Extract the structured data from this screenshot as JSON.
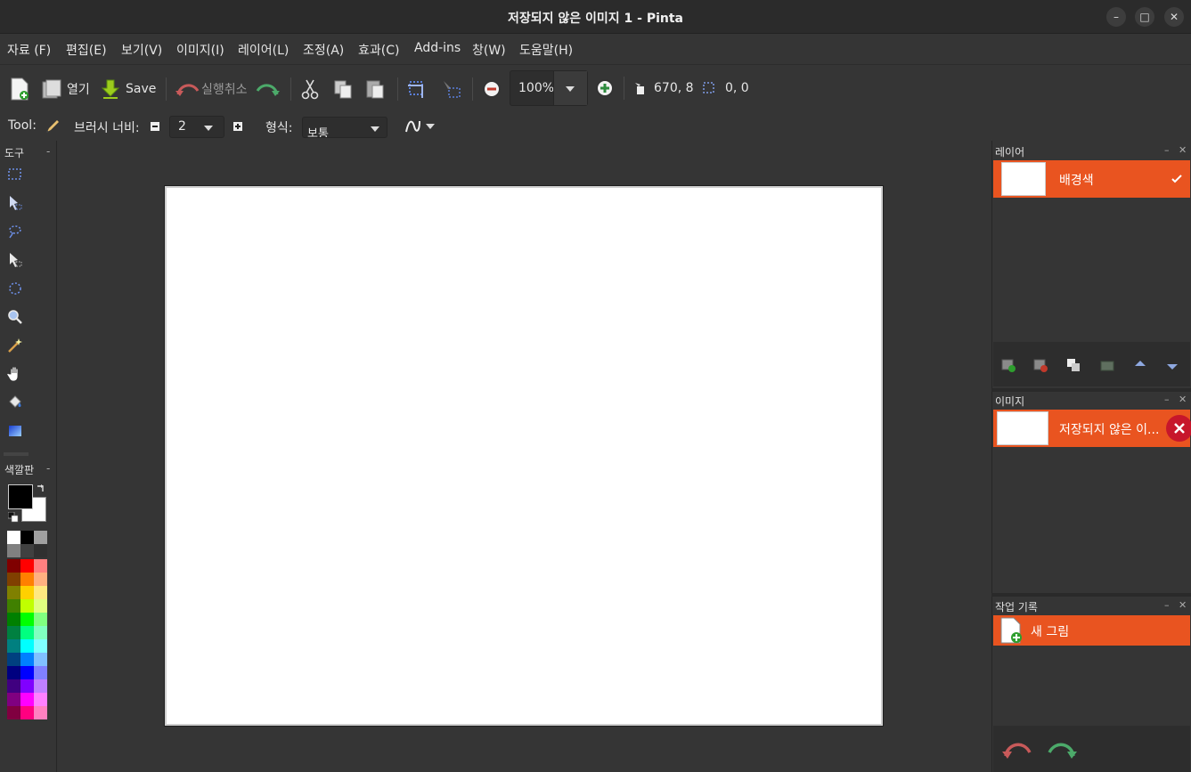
{
  "window": {
    "title": "저장되지 않은 이미지 1 - Pinta",
    "minimize": "–",
    "maximize": "□",
    "close": "✕"
  },
  "menu": {
    "items": [
      "자료 (F)",
      "편집(E)",
      "보기(V)",
      "이미지(I)",
      "레이어(L)",
      "조정(A)",
      "효과(C)",
      "Add-ins",
      "창(W)",
      "도움말(H)"
    ]
  },
  "toolbar": {
    "open_label": "열기",
    "save_label": "Save",
    "undo_label": "실행취소",
    "zoom_value": "100%",
    "cursor_position": "670, 8",
    "selection_size": "0, 0"
  },
  "tool_options": {
    "tool_label": "Tool:",
    "brush_width_label": "브러시 너비:",
    "brush_width_value": "2",
    "style_label": "형식:",
    "style_value": "보통"
  },
  "left_panel": {
    "tools_header": "도구",
    "palette_header": "색깔판",
    "tools": [
      "rectangle-select-icon",
      "move-selected-icon",
      "lasso-select-icon",
      "move-selection-icon",
      "ellipse-select-icon",
      "zoom-icon",
      "magic-wand-icon",
      "pan-icon",
      "paint-bucket-icon",
      "gradient-icon"
    ],
    "primary_color": "#000000",
    "secondary_color": "#ffffff",
    "palette_colors": [
      [
        "#ffffff",
        "#000000",
        "#a0a0a0"
      ],
      [
        "#808080",
        "#404040",
        "#303030"
      ],
      [
        "#800000",
        "#ff0000",
        "#ff8080"
      ],
      [
        "#804000",
        "#ff8000",
        "#ffb080"
      ],
      [
        "#808000",
        "#ffd000",
        "#ffe880"
      ],
      [
        "#408000",
        "#c0ff00",
        "#e0ff80"
      ],
      [
        "#008000",
        "#00ff00",
        "#80ff80"
      ],
      [
        "#008040",
        "#00ff80",
        "#80ffc0"
      ],
      [
        "#008080",
        "#00ffff",
        "#80ffff"
      ],
      [
        "#004080",
        "#0080ff",
        "#80c0ff"
      ],
      [
        "#000080",
        "#0000ff",
        "#8080ff"
      ],
      [
        "#400080",
        "#8000ff",
        "#c080ff"
      ],
      [
        "#800080",
        "#ff00ff",
        "#ff80ff"
      ],
      [
        "#800040",
        "#ff0080",
        "#ff80c0"
      ]
    ]
  },
  "layers_panel": {
    "header": "레이어",
    "layers": [
      {
        "name": "배경색",
        "visible": true
      }
    ]
  },
  "images_panel": {
    "header": "이미지",
    "images": [
      {
        "name": "저장되지 않은 이..."
      }
    ]
  },
  "history_panel": {
    "header": "작업 기록",
    "items": [
      {
        "label": "새 그림"
      }
    ]
  },
  "colors": {
    "accent": "#e95420",
    "background": "#353535",
    "canvas": "#ffffff"
  }
}
